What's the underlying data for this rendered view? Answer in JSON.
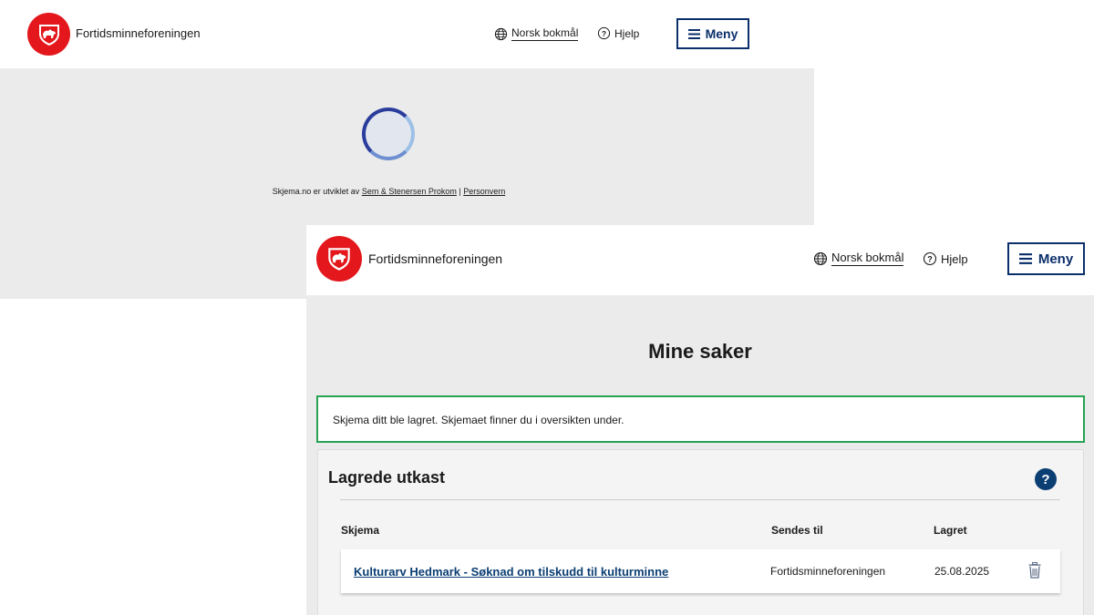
{
  "back_window": {
    "brand": "Fortidsminneforeningen",
    "language": "Norsk bokmål",
    "help": "Hjelp",
    "menu": "Meny",
    "footer": {
      "prefix": "Skjema.no er utviklet av ",
      "developer_link": "Sem & Stenersen Prokom",
      "separator": " | ",
      "privacy_link": "Personvern"
    }
  },
  "front_window": {
    "brand": "Fortidsminneforeningen",
    "language": "Norsk bokmål",
    "help": "Hjelp",
    "menu": "Meny",
    "page_title": "Mine saker",
    "alert": "Skjema ditt ble lagret. Skjemaet finner du i oversikten under.",
    "drafts": {
      "title": "Lagrede utkast",
      "help_icon": "?",
      "columns": [
        "Skjema",
        "Sendes til",
        "Lagret"
      ],
      "rows": [
        {
          "form": "Kulturarv Hedmark - Søknad om tilskudd til kulturminne",
          "recipient": "Fortidsminneforeningen",
          "saved": "25.08.2025"
        }
      ]
    }
  },
  "colors": {
    "brand_red": "#e3171c",
    "navy": "#0b2f6b",
    "success_green": "#27a352",
    "link_blue": "#0b3e73"
  },
  "icons": [
    "coat-of-arms-logo",
    "globe-icon",
    "question-circle-icon",
    "hamburger-icon",
    "loading-spinner",
    "trash-icon"
  ]
}
